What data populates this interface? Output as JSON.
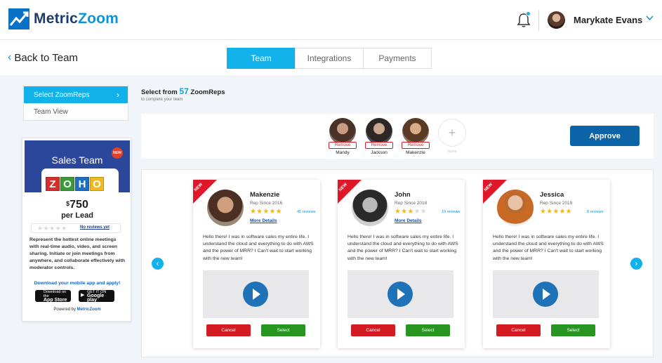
{
  "brand": {
    "name_part1": "Metric",
    "name_part2": "Zoom"
  },
  "header": {
    "user_name": "Marykate Evans"
  },
  "nav": {
    "back_label": "Back to Team",
    "tabs": [
      {
        "label": "Team",
        "active": true
      },
      {
        "label": "Integrations",
        "active": false
      },
      {
        "label": "Payments",
        "active": false
      }
    ]
  },
  "sidebar": {
    "items": [
      {
        "label": "Select ZoomReps",
        "active": true
      },
      {
        "label": "Team View",
        "active": false
      }
    ]
  },
  "promo": {
    "title": "Sales Team",
    "new_badge": "NEW",
    "logo_letters": [
      "Z",
      "O",
      "H",
      "O"
    ],
    "currency": "$",
    "price": "750",
    "per_lead": "per Lead",
    "no_reviews": "No reviews yet",
    "description": "Represent the hottest online meetings with real-time audio, video, and screen sharing. Initiate or join meetings from anywhere, and collaborate effectively with moderator controls.",
    "download_cta": "Download your mobile app and apply!",
    "app_store": {
      "small": "Download on the",
      "big": "App Store"
    },
    "google_play": {
      "small": "GET IT ON",
      "big": "Google play"
    },
    "powered_by": "Powered by",
    "powered_brand": "MetricZoom"
  },
  "select": {
    "prefix": "Select from",
    "count": "57",
    "suffix": "ZoomReps",
    "subtitle": "to complete your team"
  },
  "team": {
    "members": [
      {
        "name": "Mandy",
        "remove_label": "Remove"
      },
      {
        "name": "Jackson",
        "remove_label": "Remove"
      },
      {
        "name": "Makenzie",
        "remove_label": "Remove"
      }
    ],
    "empty_label": "Name",
    "approve_label": "Approve"
  },
  "cards": [
    {
      "ribbon": "NEW",
      "name": "Makenzie",
      "since": "Rep Since 2016",
      "rating": 5,
      "reviews": "45 reviews",
      "more": "More Details",
      "bio": "Hello there! I was in software sales my entire life. I understand the cloud and everything to do with AWS and the power of MRR? I Can't wait to start working with the new team!",
      "cancel_label": "Cancel",
      "select_label": "Select"
    },
    {
      "ribbon": "NEW",
      "name": "John",
      "since": "Rep Since 2018",
      "rating": 3,
      "reviews": "19 reviews",
      "more": "More Details",
      "bio": "Hello there! I was in software sales my entire life. I understand the cloud and everything to do with AWS and the power of MRR? I Can't wait to start working with the new team!",
      "cancel_label": "Cancel",
      "select_label": "Select"
    },
    {
      "ribbon": "NEW",
      "name": "Jessica",
      "since": "Rep Since 2019",
      "rating": 5,
      "reviews": "8 reviews",
      "more": "",
      "bio": "Hello there! I was in software sales my entire life. I understand the cloud and everything to do with AWS and the power of MRR? I Can't wait to start working with the new team!",
      "cancel_label": "Cancel",
      "select_label": "Select"
    }
  ],
  "colors": {
    "accent": "#11b2ea",
    "primary": "#0b63a8",
    "danger": "#d51b22",
    "success": "#27951f",
    "star": "#f0b820"
  }
}
